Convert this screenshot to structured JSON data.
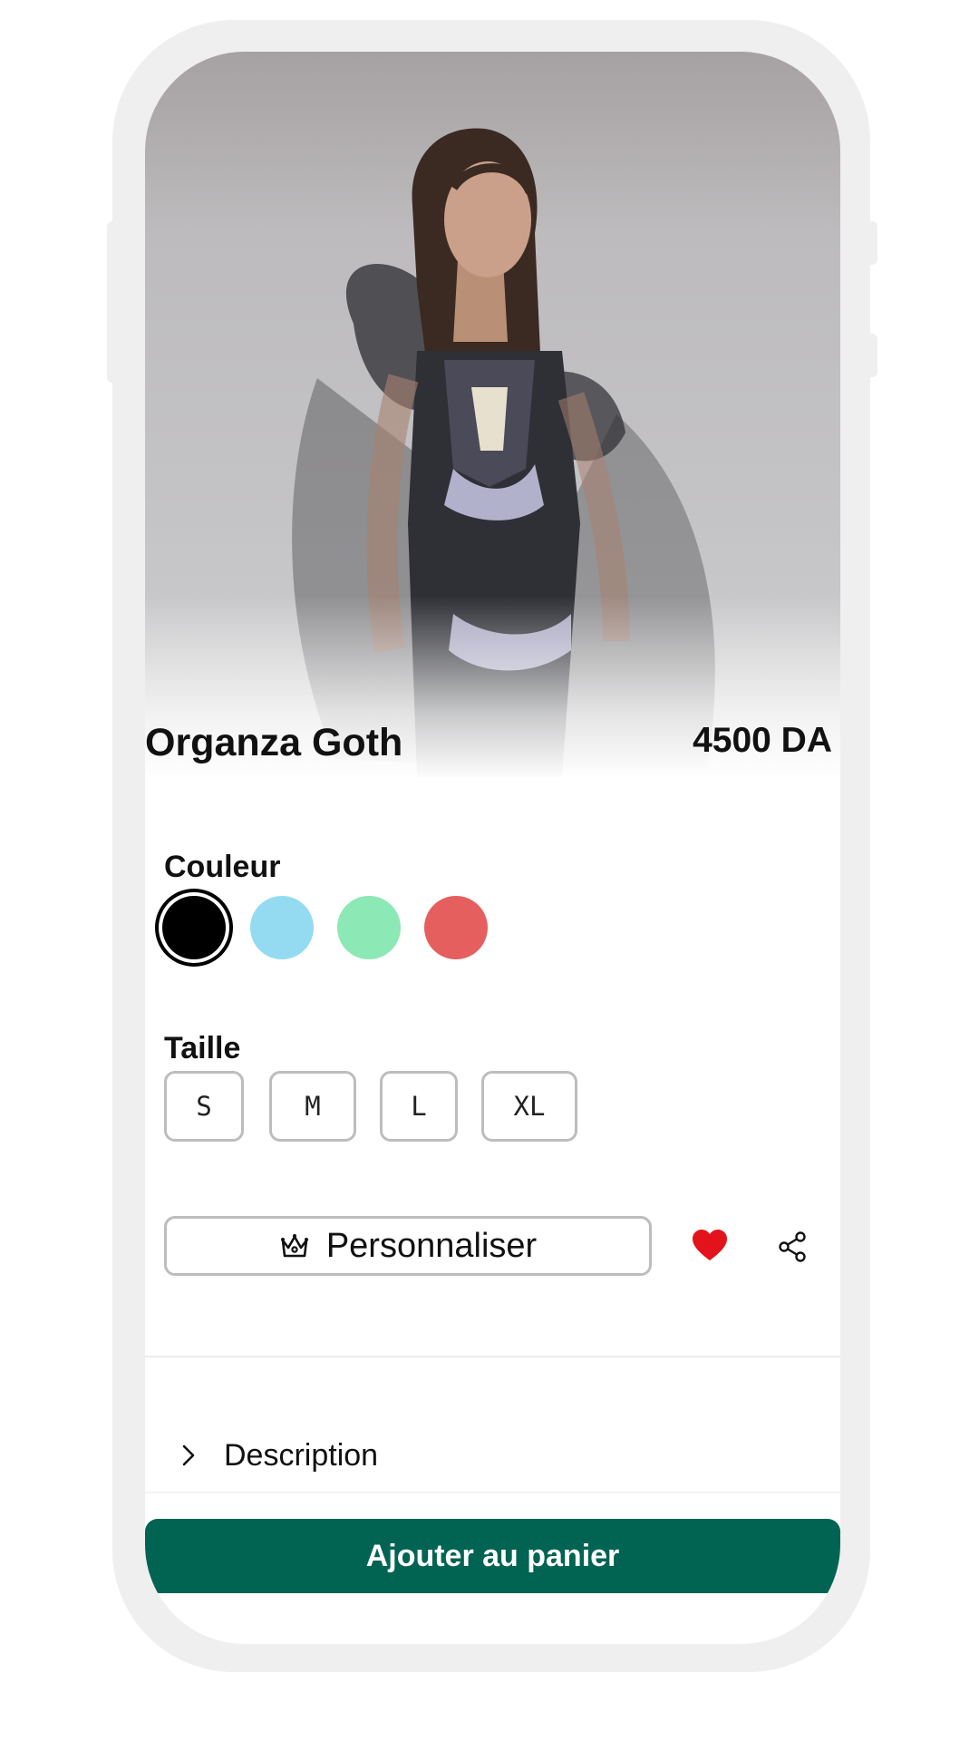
{
  "product": {
    "name": "Organza Goth",
    "price": "4500 DA"
  },
  "colors": {
    "label": "Couleur",
    "options": [
      "#000000",
      "#94dbf2",
      "#8ce8b5",
      "#e55f5f"
    ],
    "selected_index": 0
  },
  "sizes": {
    "label": "Taille",
    "options": [
      "S",
      "M",
      "L",
      "XL"
    ]
  },
  "actions": {
    "customize_label": "Personnaliser",
    "favorite_color": "#e3131b"
  },
  "accordion": {
    "description_label": "Description"
  },
  "cart": {
    "add_label": "Ajouter au panier",
    "color": "#016352"
  }
}
